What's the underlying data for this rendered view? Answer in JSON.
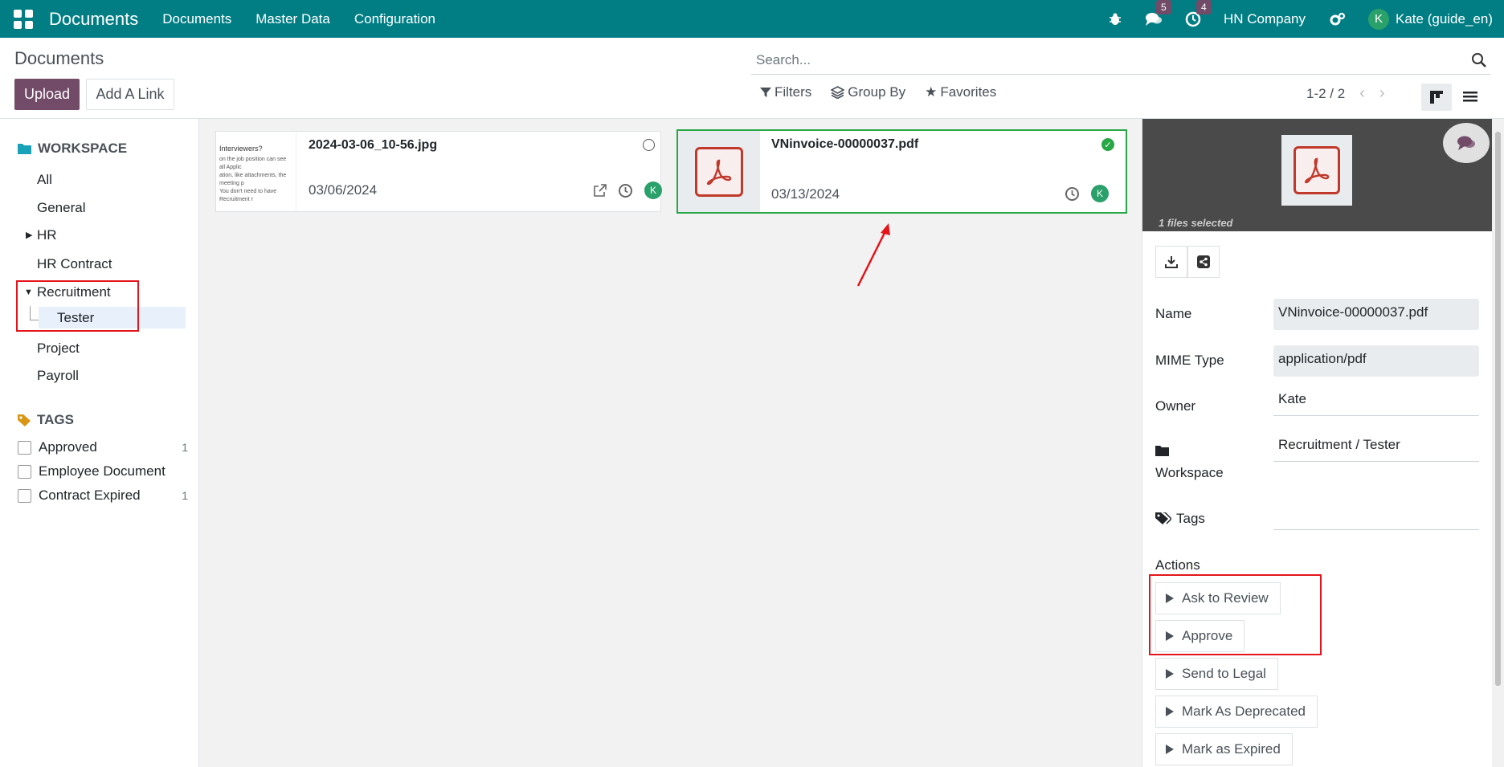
{
  "navbar": {
    "brand": "Documents",
    "menu": [
      "Documents",
      "Master Data",
      "Configuration"
    ],
    "messages_badge": "5",
    "activities_badge": "4",
    "company": "HN Company",
    "avatar_initial": "K",
    "user": "Kate (guide_en)"
  },
  "control_panel": {
    "title": "Documents",
    "upload_label": "Upload",
    "add_link_label": "Add A Link",
    "search_placeholder": "Search...",
    "filters_label": "Filters",
    "groupby_label": "Group By",
    "favorites_label": "Favorites",
    "pager": "1-2 / 2"
  },
  "sidebar": {
    "workspace_header": "WORKSPACE",
    "workspaces": [
      "All",
      "General",
      "HR",
      "HR Contract",
      "Recruitment",
      "Tester",
      "Project",
      "Payroll"
    ],
    "tags_header": "TAGS",
    "tags": [
      {
        "label": "Approved",
        "count": "1"
      },
      {
        "label": "Employee Document",
        "count": ""
      },
      {
        "label": "Contract Expired",
        "count": "1"
      }
    ]
  },
  "cards": [
    {
      "name": "2024-03-06_10-56.jpg",
      "date": "03/06/2024",
      "avatar": "K",
      "thumb_title": "Interviewers?",
      "thumb_lines": [
        "on the job position can see all Applic",
        "ation, like attachments, the meeting p",
        "You don't need to have Recruitment r"
      ]
    },
    {
      "name": "VNinvoice-00000037.pdf",
      "date": "03/13/2024",
      "avatar": "K"
    }
  ],
  "inspector": {
    "files_selected": "1 files selected",
    "name_label": "Name",
    "name_value": "VNinvoice-00000037.pdf",
    "mime_label": "MIME Type",
    "mime_value": "application/pdf",
    "owner_label": "Owner",
    "owner_value": "Kate",
    "workspace_label": "Workspace",
    "workspace_value": "Recruitment / Tester",
    "tags_label": "Tags",
    "actions_label": "Actions",
    "actions": [
      "Ask to Review",
      "Approve",
      "Send to Legal",
      "Mark As Deprecated",
      "Mark as Expired"
    ]
  },
  "colors": {
    "navbar": "#017e84",
    "primary": "#714b67",
    "selected_border": "#28a745",
    "annotation_red": "#e4141b"
  }
}
